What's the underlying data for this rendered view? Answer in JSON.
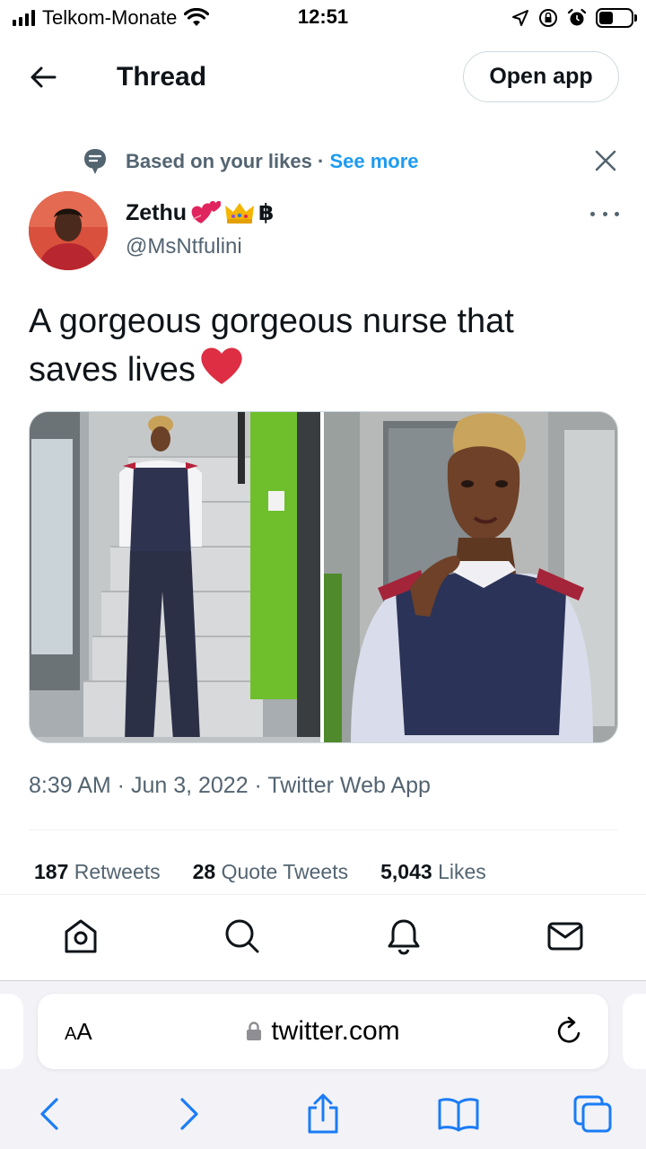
{
  "status_bar": {
    "carrier": "Telkom-Monate",
    "time": "12:51"
  },
  "header": {
    "title": "Thread",
    "open_app_label": "Open app"
  },
  "context": {
    "reason": "Based on your likes",
    "separator": "·",
    "see_more": "See more"
  },
  "author": {
    "name": "Zethu",
    "badge": "฿",
    "handle": "@MsNtfulini"
  },
  "tweet": {
    "text": "A gorgeous gorgeous nurse that saves lives",
    "meta": "8:39 AM · Jun 3, 2022 · Twitter Web App"
  },
  "stats": {
    "retweets_count": "187",
    "retweets_label": "Retweets",
    "quotes_count": "28",
    "quotes_label": "Quote Tweets",
    "likes_count": "5,043",
    "likes_label": "Likes"
  },
  "bottom_nav": {
    "icons": [
      "home-icon",
      "search-icon",
      "notifications-icon",
      "messages-icon"
    ]
  },
  "safari": {
    "aa_big": "A",
    "aa_small": "A",
    "url": "twitter.com"
  },
  "colors": {
    "accent": "#1d9bf0",
    "secondary_text": "#536471",
    "heart": "#e0245e"
  }
}
